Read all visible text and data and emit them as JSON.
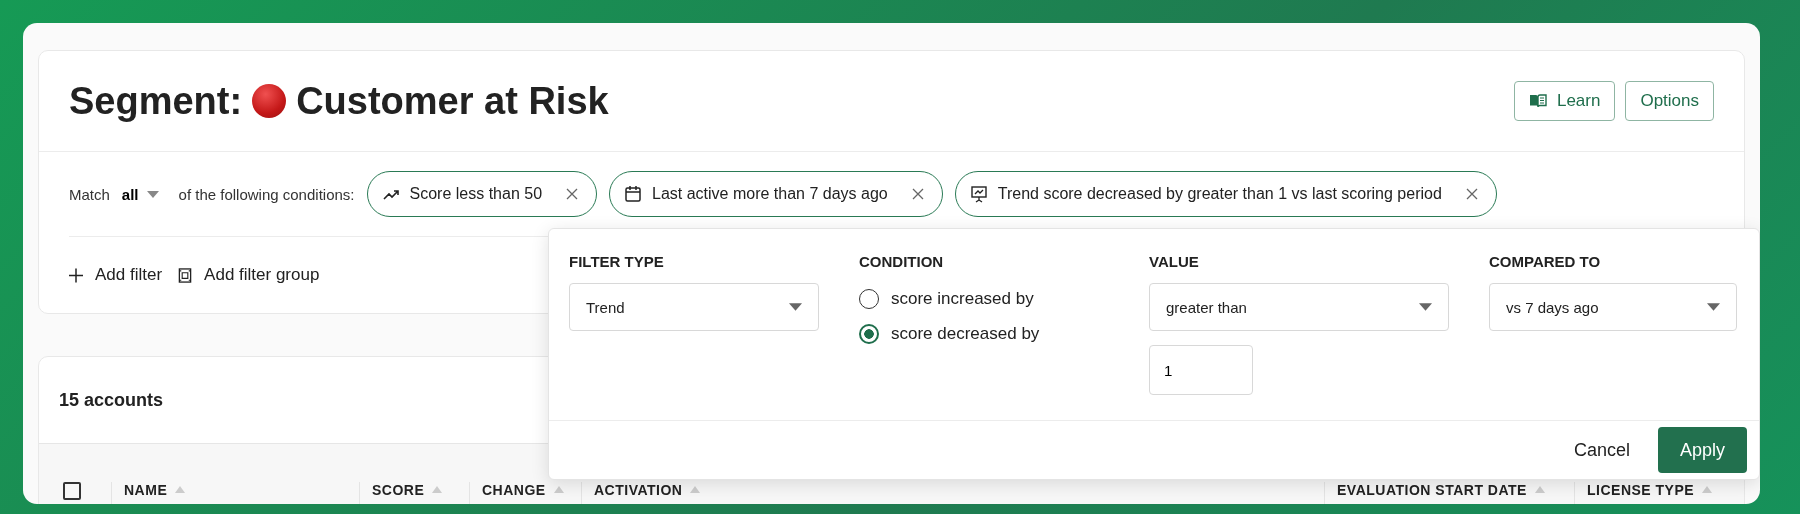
{
  "header": {
    "title_prefix": "Segment:",
    "title": "Customer at Risk",
    "buttons": [
      {
        "label": "Learn",
        "kind": "book"
      },
      {
        "label": "Options",
        "kind": "plain"
      }
    ]
  },
  "filters": {
    "match_label": "Match",
    "match_value": "all",
    "suffix": "of the following conditions:",
    "chips": [
      {
        "label": "Score less than 50",
        "kind": "trend"
      },
      {
        "label": "Last active more than 7 days ago",
        "kind": "calendar"
      },
      {
        "label": "Trend score decreased by greater than 1 vs last scoring period",
        "kind": "chart"
      }
    ],
    "actions": [
      {
        "label": "Add filter",
        "kind": "plus"
      },
      {
        "label": "Add filter group",
        "kind": "group"
      }
    ]
  },
  "popup": {
    "filter_type": {
      "label": "FILTER TYPE",
      "value": "Trend"
    },
    "condition": {
      "label": "CONDITION",
      "options": [
        {
          "label": "score increased by",
          "selected": false
        },
        {
          "label": "score decreased by",
          "selected": true
        }
      ]
    },
    "value": {
      "label": "VALUE",
      "operator": "greater than",
      "amount": "1"
    },
    "compared_to": {
      "label": "COMPARED TO",
      "value": "vs 7 days ago"
    },
    "cancel": "Cancel",
    "apply": "Apply"
  },
  "accounts": {
    "count": "15 accounts",
    "select_all_checked": false,
    "columns": [
      {
        "label": "NAME"
      },
      {
        "label": "SCORE"
      },
      {
        "label": "CHANGE"
      },
      {
        "label": "ACTIVATION"
      },
      {
        "label": "EVALUATION START DATE"
      },
      {
        "label": "LICENSE TYPE"
      }
    ]
  }
}
